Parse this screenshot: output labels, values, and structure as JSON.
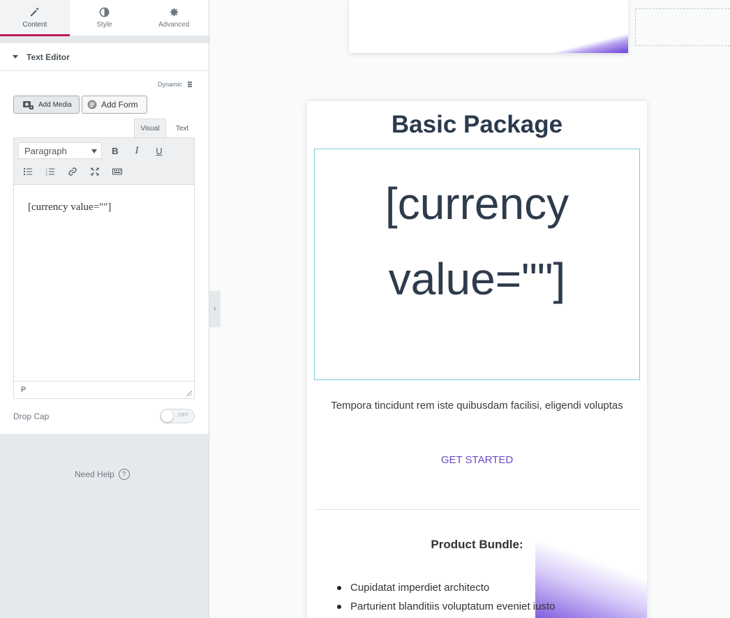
{
  "panel": {
    "tabs": [
      {
        "label": "Content",
        "icon": "pencil-icon"
      },
      {
        "label": "Style",
        "icon": "half-circle-icon"
      },
      {
        "label": "Advanced",
        "icon": "gear-icon"
      }
    ],
    "section_title": "Text Editor",
    "dynamic_label": "Dynamic",
    "add_media_label": "Add Media",
    "add_form_label": "Add Form",
    "mode_tabs": {
      "visual": "Visual",
      "text": "Text"
    },
    "format_select": "Paragraph",
    "toolbar_buttons": [
      "B",
      "I",
      "U"
    ],
    "editor_content": "[currency value=\"\"]",
    "status_path": "P",
    "drop_cap_label": "Drop Cap",
    "toggle_state": "OFF",
    "need_help": "Need Help",
    "help_symbol": "?"
  },
  "preview": {
    "package_title": "Basic Package",
    "price_line1": "[currency",
    "price_line2": "value=\"\"]",
    "description": "Tempora tincidunt rem iste quibusdam facilisi, eligendi voluptas",
    "cta": "GET STARTED",
    "bundle_title": "Product Bundle:",
    "bundle_items": [
      "Cupidatat imperdiet architecto",
      "Parturient blanditiis voluptatum eveniet iusto"
    ]
  },
  "colors": {
    "accent": "#c2185b",
    "cta": "#6a4bc4",
    "gradient": "#6c3fd6",
    "price_border": "#7ec8d3"
  }
}
